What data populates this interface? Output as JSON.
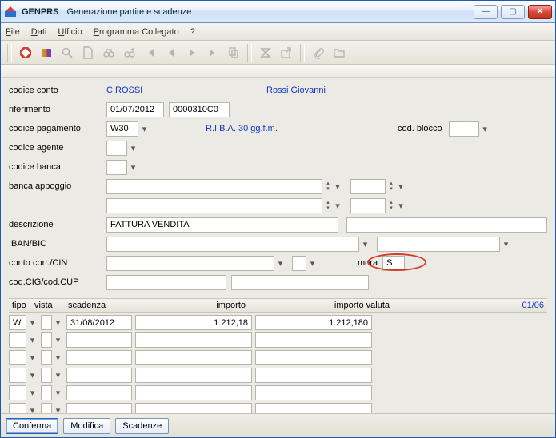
{
  "window": {
    "app_code": "GENPRS",
    "title": "Generazione partite e scadenze"
  },
  "menu": {
    "file": "File",
    "dati": "Dati",
    "ufficio": "Ufficio",
    "programma": "Programma Collegato",
    "help": "?"
  },
  "labels": {
    "codice_conto": "codice conto",
    "riferimento": "riferimento",
    "codice_pagamento": "codice pagamento",
    "cod_blocco": "cod. blocco",
    "codice_agente": "codice agente",
    "codice_banca": "codice banca",
    "banca_appoggio": "banca appoggio",
    "descrizione": "descrizione",
    "iban_bic": "IBAN/BIC",
    "conto_corr_cin": "conto corr./CIN",
    "cod_cig_cup": "cod.CIG/cod.CUP",
    "mora": "mora"
  },
  "values": {
    "codice_conto": "C  ROSSI",
    "codice_conto_desc": "Rossi Giovanni",
    "rif_data": "01/07/2012",
    "rif_code": "0000310C0",
    "pagamento_code": "W30",
    "pagamento_desc": "R.I.B.A. 30 gg.f.m.",
    "cod_blocco": "",
    "codice_agente": "",
    "codice_banca": "",
    "banca_appoggio_1": "",
    "banca_appoggio_2": "",
    "banca_appoggio_r1": "",
    "banca_appoggio_r2": "",
    "descrizione": "FATTURA VENDITA",
    "descrizione_r": "",
    "iban": "",
    "bic": "",
    "conto_corr": "",
    "cin": "",
    "mora": "S",
    "cig": "",
    "cup": ""
  },
  "grid": {
    "headers": {
      "tipo": "tipo",
      "vista": "vista",
      "scadenza": "scadenza",
      "importo": "importo",
      "importo_valuta": "importo valuta",
      "pager": "01/06"
    },
    "rows": [
      {
        "tipo": "W",
        "vista": "",
        "scadenza": "31/08/2012",
        "importo": "1.212,18",
        "importo_valuta": "1.212,180"
      },
      {
        "tipo": "",
        "vista": "",
        "scadenza": "",
        "importo": "",
        "importo_valuta": ""
      },
      {
        "tipo": "",
        "vista": "",
        "scadenza": "",
        "importo": "",
        "importo_valuta": ""
      },
      {
        "tipo": "",
        "vista": "",
        "scadenza": "",
        "importo": "",
        "importo_valuta": ""
      },
      {
        "tipo": "",
        "vista": "",
        "scadenza": "",
        "importo": "",
        "importo_valuta": ""
      },
      {
        "tipo": "",
        "vista": "",
        "scadenza": "",
        "importo": "",
        "importo_valuta": ""
      }
    ]
  },
  "buttons": {
    "conferma": "Conferma",
    "modifica": "Modifica",
    "scadenze": "Scadenze"
  },
  "icons": {
    "stop": "stop-icon",
    "book": "book-icon",
    "search": "search-icon",
    "doc": "doc-icon",
    "binoc": "binoc-icon",
    "binoc_plus": "binoc-plus-icon",
    "first": "first-icon",
    "prev": "prev-icon",
    "next": "next-icon",
    "last": "last-icon",
    "copy": "copy-icon",
    "sigma": "sigma-icon",
    "export": "export-icon",
    "attach": "attach-icon",
    "folder": "folder-icon"
  }
}
